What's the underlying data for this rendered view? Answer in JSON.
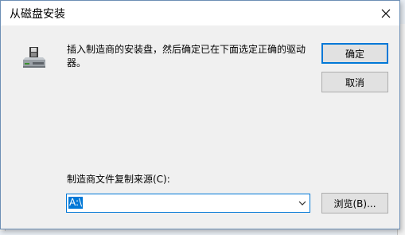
{
  "dialog": {
    "title": "从磁盘安装",
    "instruction": "插入制造商的安装盘，然后确定已在下面选定正确的驱动器。",
    "buttons": {
      "ok": "确定",
      "cancel": "取消",
      "browse": "浏览(B)..."
    },
    "source": {
      "label": "制造商文件复制来源(C):",
      "value": "A:\\"
    },
    "icons": {
      "close": "close-icon",
      "disk": "floppy-disk-drive-icon",
      "dropdown": "chevron-down-icon"
    },
    "colors": {
      "accent": "#0078d7",
      "button_face": "#e1e1e1",
      "dialog_face": "#f0f0f0"
    }
  }
}
